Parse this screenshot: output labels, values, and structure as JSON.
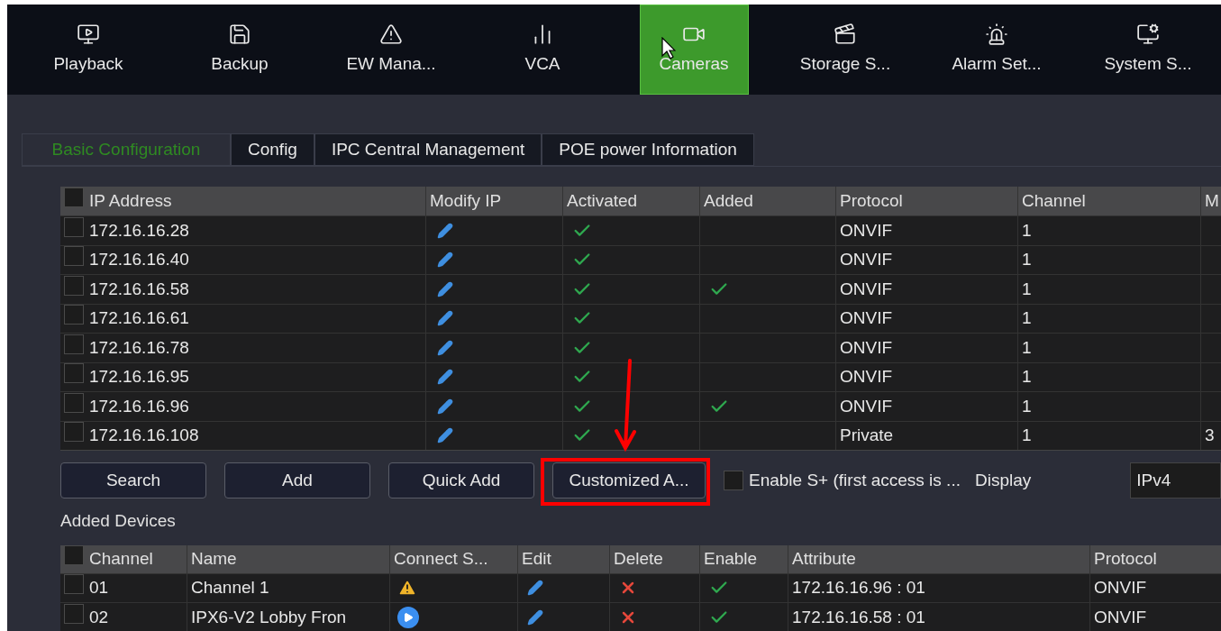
{
  "nav": [
    {
      "label": "Playback",
      "kind": "playback",
      "selected": false
    },
    {
      "label": "Backup",
      "kind": "backup",
      "selected": false
    },
    {
      "label": "EW Mana...",
      "kind": "warning-gear",
      "selected": false
    },
    {
      "label": "VCA",
      "kind": "bars",
      "selected": false
    },
    {
      "label": "Cameras",
      "kind": "camera",
      "selected": true
    },
    {
      "label": "Storage S...",
      "kind": "storage",
      "selected": false
    },
    {
      "label": "Alarm Set...",
      "kind": "alarm",
      "selected": false
    },
    {
      "label": "System S...",
      "kind": "system",
      "selected": false
    }
  ],
  "tabs": [
    {
      "label": "Basic Configuration",
      "selected": true
    },
    {
      "label": "Config",
      "selected": false
    },
    {
      "label": "IPC Central Management",
      "selected": false
    },
    {
      "label": "POE power Information",
      "selected": false
    }
  ],
  "devices_table": {
    "columns": [
      "IP Address",
      "Modify IP",
      "Activated",
      "Added",
      "Protocol",
      "Channel",
      "M"
    ],
    "all_checked": false,
    "rows": [
      {
        "checked": false,
        "ip": "172.16.16.28",
        "activated": true,
        "added": false,
        "protocol": "ONVIF",
        "channel": "1"
      },
      {
        "checked": false,
        "ip": "172.16.16.40",
        "activated": true,
        "added": false,
        "protocol": "ONVIF",
        "channel": "1"
      },
      {
        "checked": false,
        "ip": "172.16.16.58",
        "activated": true,
        "added": true,
        "protocol": "ONVIF",
        "channel": "1"
      },
      {
        "checked": false,
        "ip": "172.16.16.61",
        "activated": true,
        "added": false,
        "protocol": "ONVIF",
        "channel": "1"
      },
      {
        "checked": false,
        "ip": "172.16.16.78",
        "activated": true,
        "added": false,
        "protocol": "ONVIF",
        "channel": "1"
      },
      {
        "checked": false,
        "ip": "172.16.16.95",
        "activated": true,
        "added": false,
        "protocol": "ONVIF",
        "channel": "1"
      },
      {
        "checked": false,
        "ip": "172.16.16.96",
        "activated": true,
        "added": true,
        "protocol": "ONVIF",
        "channel": "1"
      },
      {
        "checked": false,
        "ip": "172.16.16.108",
        "activated": true,
        "added": false,
        "protocol": "Private",
        "channel": "1",
        "column_7": "3"
      }
    ]
  },
  "buttons": [
    "Search",
    "Add",
    "Quick Add",
    "Customized A..."
  ],
  "enable_s_plus": {
    "label": "Enable S+ (first access is ...",
    "checked": false
  },
  "display": {
    "label": "Display",
    "value": "IPv4"
  },
  "added_devices": {
    "title": "Added Devices",
    "columns": [
      "Channel",
      "Name",
      "Connect S...",
      "Edit",
      "Delete",
      "Enable",
      "Attribute",
      "Protocol"
    ],
    "all_checked": false,
    "rows": [
      {
        "checked": false,
        "channel": "01",
        "name": "Channel 1",
        "connect_status": {
          "kind": "warning"
        },
        "enabled": true,
        "attribute": "172.16.16.96 : 01",
        "protocol": "ONVIF"
      },
      {
        "checked": false,
        "channel": "02",
        "name": "IPX6-V2 Lobby Fron",
        "connect_status": {
          "kind": "playing"
        },
        "enabled": true,
        "attribute": "172.16.16.58 : 01",
        "protocol": "ONVIF"
      }
    ]
  }
}
